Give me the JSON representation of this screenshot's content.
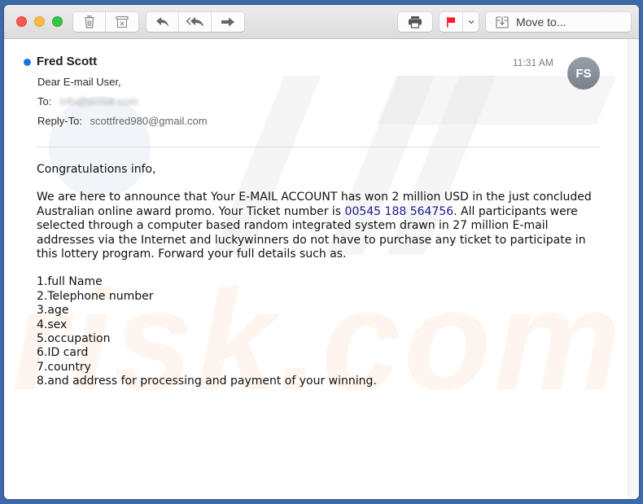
{
  "toolbar": {
    "window_controls": [
      "close",
      "minimize",
      "maximize"
    ],
    "delete_icon": "trash-icon",
    "junk_icon": "archive-junk-icon",
    "reply_icon": "reply-icon",
    "reply_all_icon": "reply-all-icon",
    "forward_icon": "forward-icon",
    "print_icon": "printer-icon",
    "flag_icon": "flag-icon",
    "flag_color": "#ff1a2e",
    "move_label": "Move to..."
  },
  "message": {
    "sender": "Fred Scott",
    "unread": true,
    "subject": "Dear E-mail User,",
    "to_label": "To:",
    "to_value": "info@pcrisk.com",
    "reply_to_label": "Reply-To:",
    "reply_to_value": "scottfred980@gmail.com",
    "time": "11:31 AM",
    "avatar_initials": "FS",
    "body": {
      "greeting": "Congratulations info,",
      "paragraph_before_ticket": "We are here to announce that Your E-MAIL ACCOUNT has won 2 million USD in the just concluded Australian online award promo. Your Ticket number is ",
      "ticket_number": "00545 188 564756",
      "paragraph_after_ticket": ". All participants were selected through a computer based random integrated system drawn in 27 million E-mail addresses via the Internet and luckywinners do not have to purchase any ticket to participate in this lottery program. Forward your full details such as.",
      "list": [
        "1.full Name",
        "2.Telephone number",
        "3.age",
        "4.sex",
        "5.occupation",
        "6.ID card",
        "7.country",
        "8.and address for processing and payment of your winning."
      ]
    }
  },
  "colors": {
    "unread_dot": "#1a73e8",
    "ticket_link": "#1a1a8c",
    "desktop": "#3d6aa8"
  }
}
